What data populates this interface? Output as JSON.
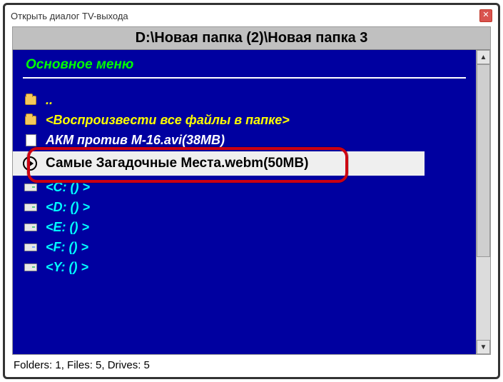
{
  "window": {
    "title": "Открыть диалог TV-выхода",
    "close_glyph": "✕"
  },
  "path_bar": "D:\\Новая папка (2)\\Новая папка 3",
  "menu_header": "Основное меню",
  "items": {
    "parent_dir": "..",
    "play_all": "<Воспроизвести все файлы в папке>",
    "file0": "АКМ против М-16.avi(38MB)",
    "selected": "Самые Загадочные Места.webm(50MB)",
    "drive_c": "<C: () >",
    "drive_d": "<D: () >",
    "drive_e": "<E: () >",
    "drive_f": "<F: () >",
    "drive_y": "<Y: () >"
  },
  "scrollbar": {
    "up": "▲",
    "down": "▼"
  },
  "status_bar": "Folders: 1, Files: 5, Drives: 5"
}
